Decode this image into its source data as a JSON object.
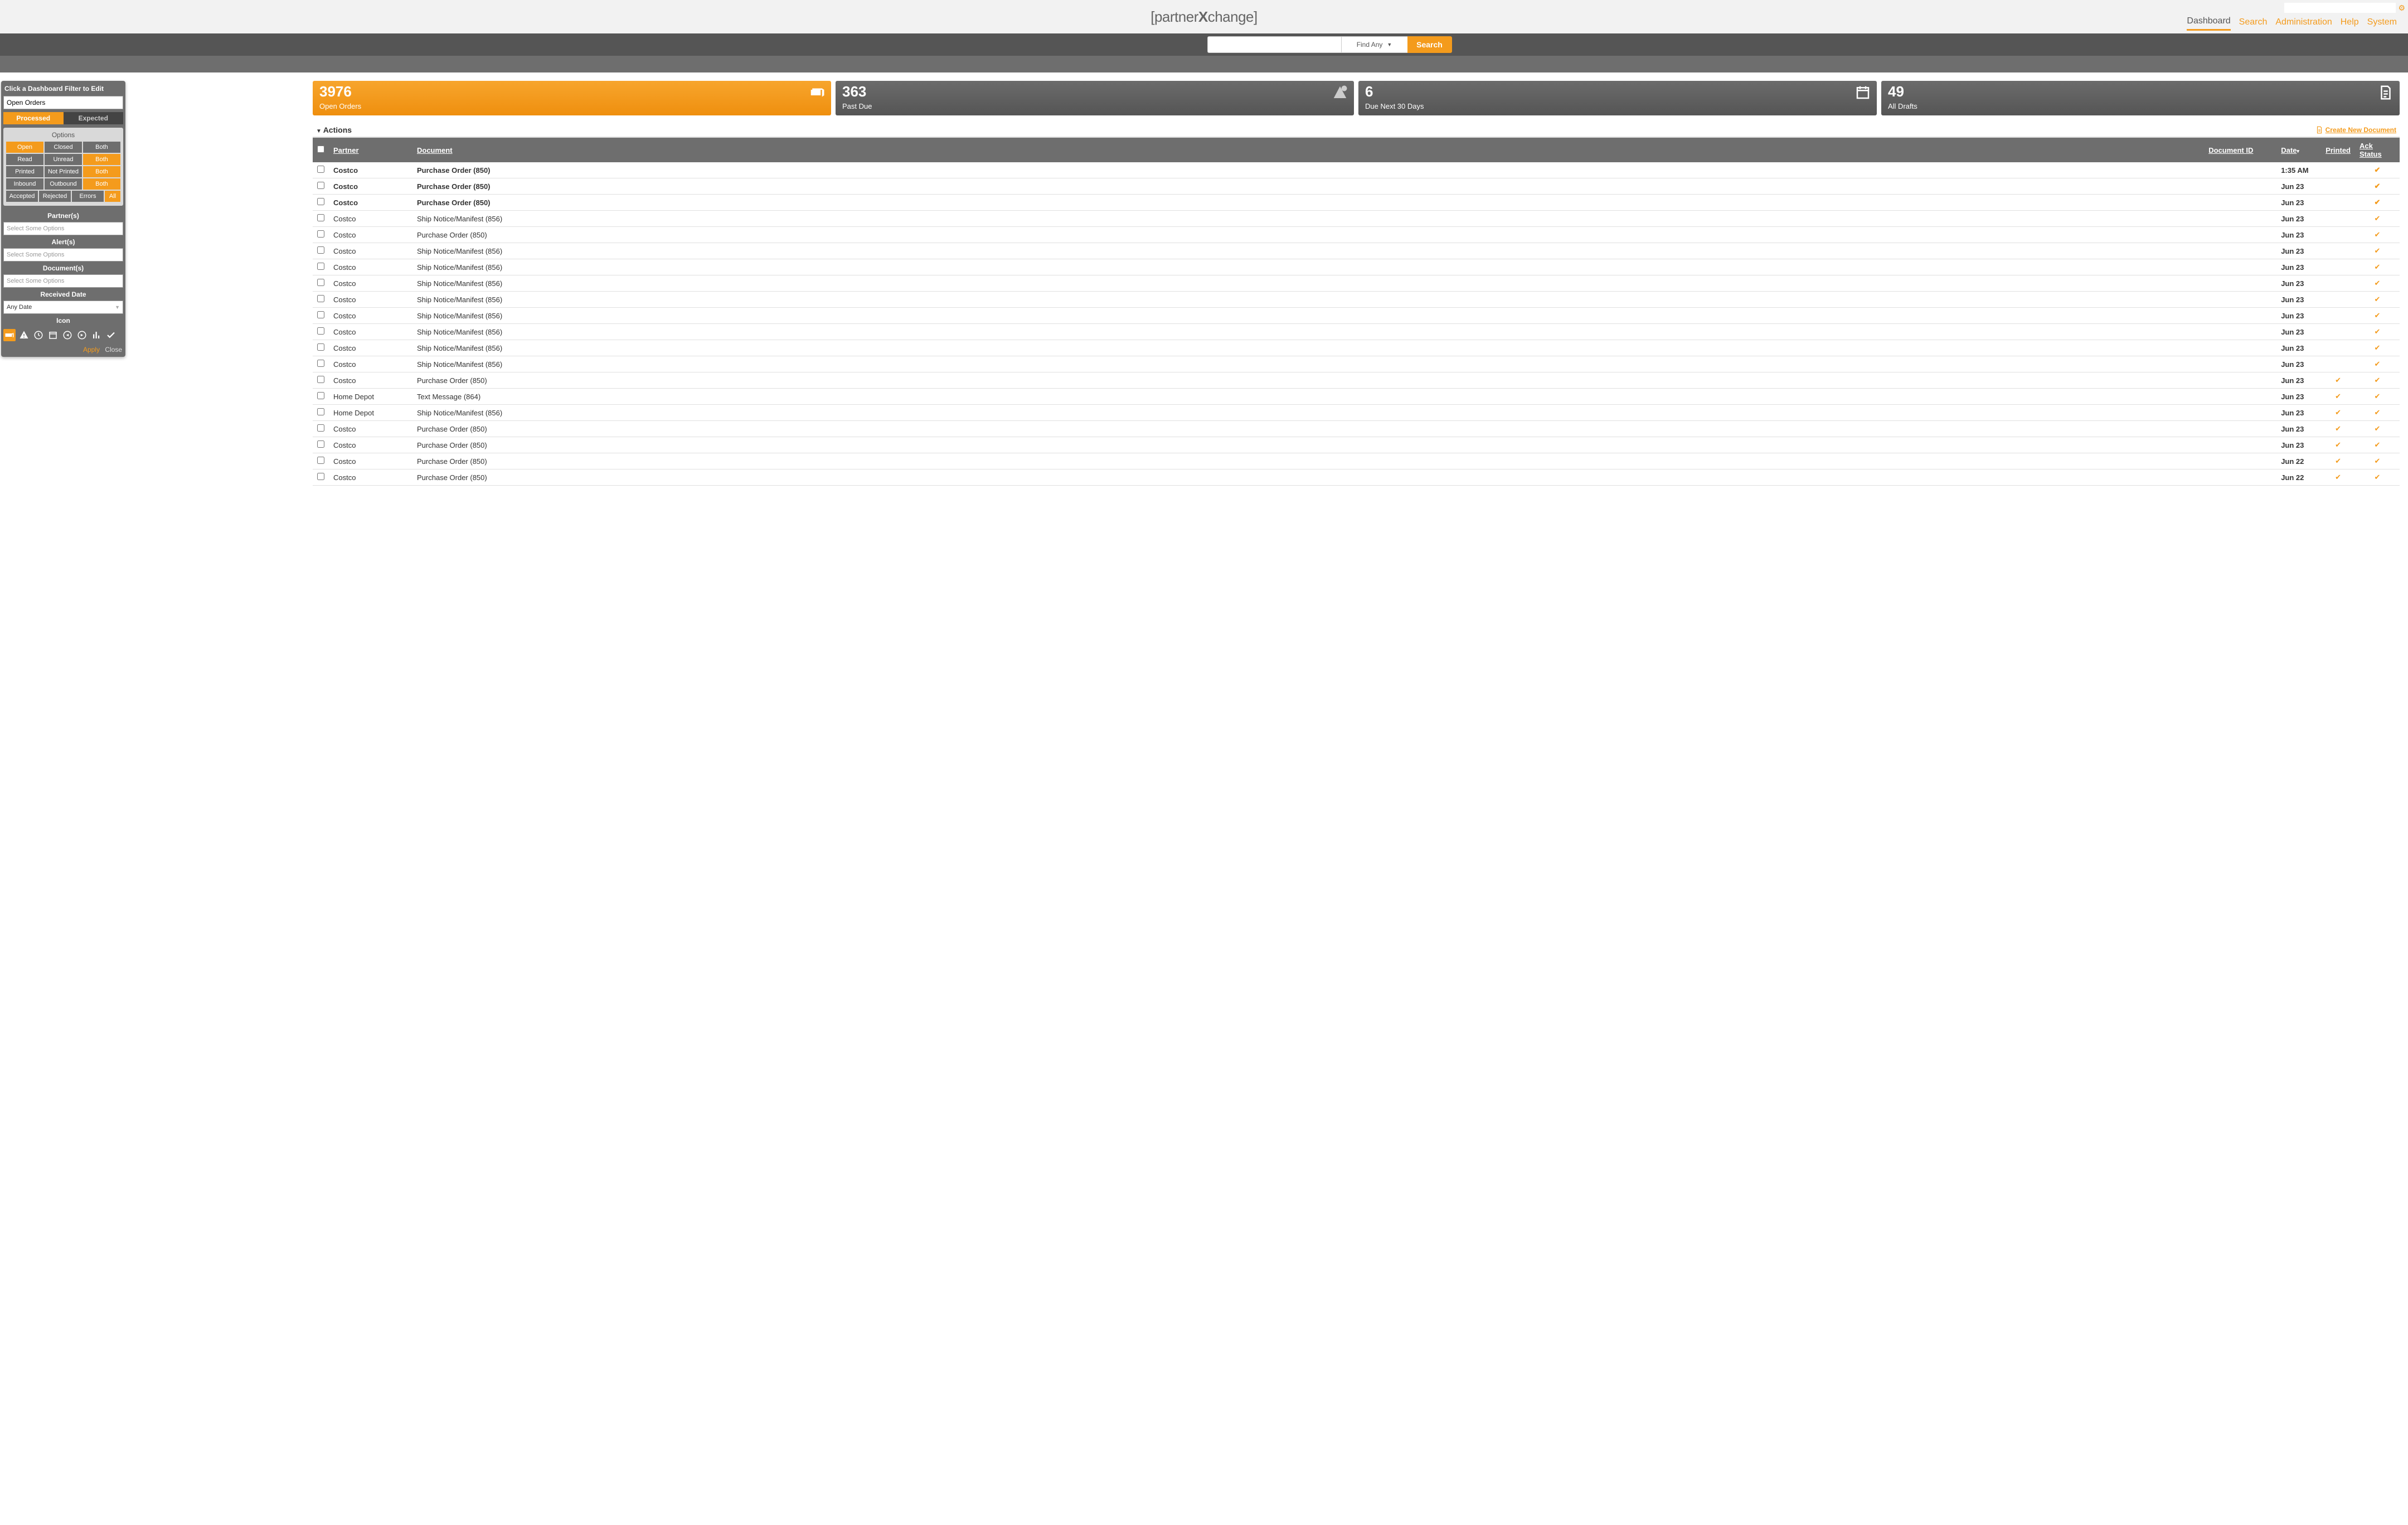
{
  "brand": {
    "open": "[",
    "name": "partner",
    "bold": "X",
    "rest": "change",
    "close": "]"
  },
  "topnav": [
    {
      "label": "Dashboard",
      "active": true
    },
    {
      "label": "Search",
      "active": false
    },
    {
      "label": "Administration",
      "active": false
    },
    {
      "label": "Help",
      "active": false
    },
    {
      "label": "System",
      "active": false
    }
  ],
  "search": {
    "placeholder": "",
    "mode": "Find Any",
    "button": "Search"
  },
  "filter": {
    "title": "Click a Dashboard Filter to Edit",
    "name_value": "Open Orders",
    "tabs": [
      {
        "label": "Processed",
        "active": true
      },
      {
        "label": "Expected",
        "active": false
      }
    ],
    "options_label": "Options",
    "row1": [
      {
        "label": "Open",
        "active": true
      },
      {
        "label": "Closed",
        "active": false
      },
      {
        "label": "Both",
        "active": false
      }
    ],
    "row2": [
      {
        "label": "Read",
        "active": false
      },
      {
        "label": "Unread",
        "active": false
      },
      {
        "label": "Both",
        "active": true
      }
    ],
    "row3": [
      {
        "label": "Printed",
        "active": false
      },
      {
        "label": "Not Printed",
        "active": false
      },
      {
        "label": "Both",
        "active": true
      }
    ],
    "row4": [
      {
        "label": "Inbound",
        "active": false
      },
      {
        "label": "Outbound",
        "active": false
      },
      {
        "label": "Both",
        "active": true
      }
    ],
    "row5": [
      {
        "label": "Accepted",
        "active": false
      },
      {
        "label": "Rejected",
        "active": false
      },
      {
        "label": "Errors",
        "active": false
      },
      {
        "label": "All",
        "active": true
      }
    ],
    "partners_label": "Partner(s)",
    "partners_placeholder": "Select Some Options",
    "alerts_label": "Alert(s)",
    "alerts_placeholder": "Select Some Options",
    "documents_label": "Document(s)",
    "documents_placeholder": "Select Some Options",
    "received_label": "Received Date",
    "received_value": "Any Date",
    "icon_label": "Icon",
    "apply": "Apply",
    "close": "Close"
  },
  "tiles": [
    {
      "count": "3976",
      "label": "Open Orders",
      "active": true,
      "icon": "cash"
    },
    {
      "count": "363",
      "label": "Past Due",
      "active": false,
      "icon": "pastdue"
    },
    {
      "count": "6",
      "label": "Due Next 30 Days",
      "active": false,
      "icon": "calendar"
    },
    {
      "count": "49",
      "label": "All Drafts",
      "active": false,
      "icon": "draft"
    }
  ],
  "actions": {
    "label": "Actions",
    "create": "Create New Document"
  },
  "table": {
    "headers": {
      "partner": "Partner",
      "document": "Document",
      "doc_id": "Document ID",
      "date": "Date",
      "printed": "Printed",
      "ack": "Ack Status"
    },
    "rows": [
      {
        "partner": "Costco",
        "document": "Purchase Order (850)",
        "doc_id": "",
        "date": "1:35 AM",
        "printed": false,
        "ack": true,
        "unread": true
      },
      {
        "partner": "Costco",
        "document": "Purchase Order (850)",
        "doc_id": "",
        "date": "Jun 23",
        "printed": false,
        "ack": true,
        "unread": true
      },
      {
        "partner": "Costco",
        "document": "Purchase Order (850)",
        "doc_id": "",
        "date": "Jun 23",
        "printed": false,
        "ack": true,
        "unread": true
      },
      {
        "partner": "Costco",
        "document": "Ship Notice/Manifest (856)",
        "doc_id": "",
        "date": "Jun 23",
        "printed": false,
        "ack": true,
        "unread": false
      },
      {
        "partner": "Costco",
        "document": "Purchase Order (850)",
        "doc_id": "",
        "date": "Jun 23",
        "printed": false,
        "ack": true,
        "unread": false
      },
      {
        "partner": "Costco",
        "document": "Ship Notice/Manifest (856)",
        "doc_id": "",
        "date": "Jun 23",
        "printed": false,
        "ack": true,
        "unread": false
      },
      {
        "partner": "Costco",
        "document": "Ship Notice/Manifest (856)",
        "doc_id": "",
        "date": "Jun 23",
        "printed": false,
        "ack": true,
        "unread": false
      },
      {
        "partner": "Costco",
        "document": "Ship Notice/Manifest (856)",
        "doc_id": "",
        "date": "Jun 23",
        "printed": false,
        "ack": true,
        "unread": false
      },
      {
        "partner": "Costco",
        "document": "Ship Notice/Manifest (856)",
        "doc_id": "",
        "date": "Jun 23",
        "printed": false,
        "ack": true,
        "unread": false
      },
      {
        "partner": "Costco",
        "document": "Ship Notice/Manifest (856)",
        "doc_id": "",
        "date": "Jun 23",
        "printed": false,
        "ack": true,
        "unread": false
      },
      {
        "partner": "Costco",
        "document": "Ship Notice/Manifest (856)",
        "doc_id": "",
        "date": "Jun 23",
        "printed": false,
        "ack": true,
        "unread": false
      },
      {
        "partner": "Costco",
        "document": "Ship Notice/Manifest (856)",
        "doc_id": "",
        "date": "Jun 23",
        "printed": false,
        "ack": true,
        "unread": false
      },
      {
        "partner": "Costco",
        "document": "Ship Notice/Manifest (856)",
        "doc_id": "",
        "date": "Jun 23",
        "printed": false,
        "ack": true,
        "unread": false
      },
      {
        "partner": "Costco",
        "document": "Purchase Order (850)",
        "doc_id": "",
        "date": "Jun 23",
        "printed": true,
        "ack": true,
        "unread": false
      },
      {
        "partner": "Home Depot",
        "document": "Text Message (864)",
        "doc_id": "",
        "date": "Jun 23",
        "printed": true,
        "ack": true,
        "unread": false
      },
      {
        "partner": "Home Depot",
        "document": "Ship Notice/Manifest (856)",
        "doc_id": "",
        "date": "Jun 23",
        "printed": true,
        "ack": true,
        "unread": false
      },
      {
        "partner": "Costco",
        "document": "Purchase Order (850)",
        "doc_id": "",
        "date": "Jun 23",
        "printed": true,
        "ack": true,
        "unread": false
      },
      {
        "partner": "Costco",
        "document": "Purchase Order (850)",
        "doc_id": "",
        "date": "Jun 23",
        "printed": true,
        "ack": true,
        "unread": false
      },
      {
        "partner": "Costco",
        "document": "Purchase Order (850)",
        "doc_id": "",
        "date": "Jun 22",
        "printed": true,
        "ack": true,
        "unread": false
      },
      {
        "partner": "Costco",
        "document": "Purchase Order (850)",
        "doc_id": "",
        "date": "Jun 22",
        "printed": true,
        "ack": true,
        "unread": false
      }
    ]
  }
}
